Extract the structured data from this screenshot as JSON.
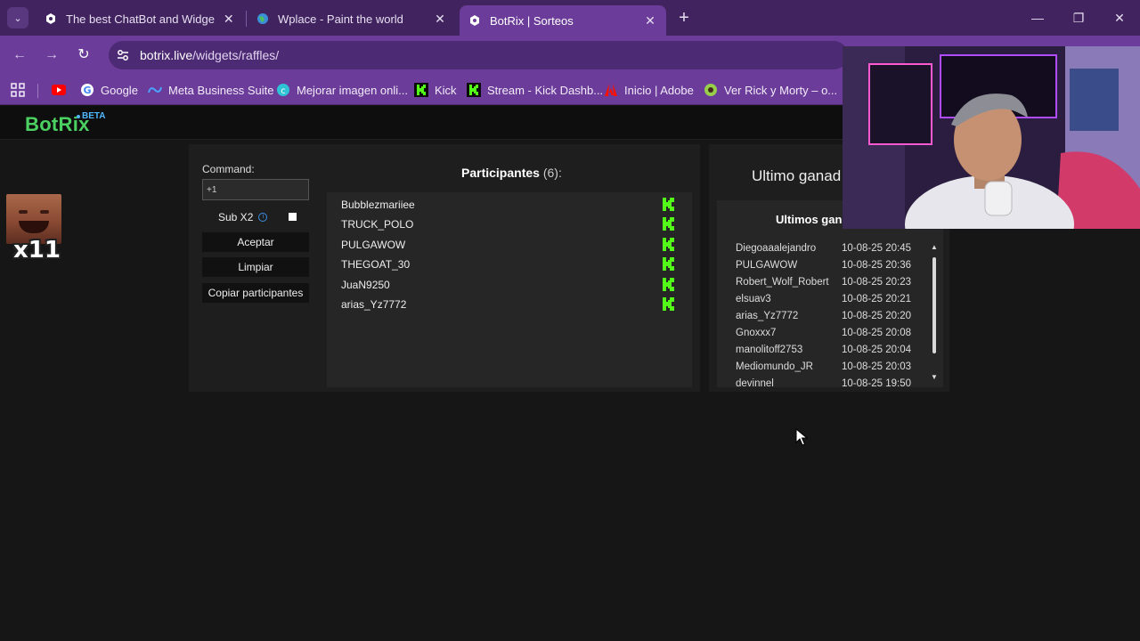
{
  "browser": {
    "tabs": [
      {
        "title": "The best ChatBot and Widgets f",
        "active": false
      },
      {
        "title": "Wplace - Paint the world",
        "active": false
      },
      {
        "title": "BotRix | Sorteos",
        "active": true
      }
    ],
    "url_host": "botrix.live",
    "url_path": "/widgets/raffles/",
    "bookmarks": [
      {
        "label": ""
      },
      {
        "label": "Google"
      },
      {
        "label": "Meta Business Suite"
      },
      {
        "label": "Mejorar imagen onli..."
      },
      {
        "label": "Kick"
      },
      {
        "label": "Stream - Kick Dashb..."
      },
      {
        "label": "Inicio | Adobe"
      },
      {
        "label": "Ver Rick y Morty – o..."
      }
    ]
  },
  "site": {
    "logo": "BotRix",
    "beta": "BETA"
  },
  "emote": {
    "label": "x11"
  },
  "raffle": {
    "command_label": "Command:",
    "command_value": "+1",
    "sub_label": "Sub X2",
    "accept_label": "Aceptar",
    "clear_label": "Limpiar",
    "copy_label": "Copiar participantes",
    "participants_title": "Participantes",
    "participants_count": "(6):",
    "participants": [
      "Bubblezmariiee",
      "TRUCK_POLO",
      "PULGAWOW",
      "THEGOAT_30",
      "JuaN9250",
      "arias_Yz7772"
    ]
  },
  "winners": {
    "last_winner_title": "Ultimo ganad",
    "history_title": "Ultimos gan",
    "rows": [
      {
        "name": "Diegoaaalejandro",
        "date": "10-08-25 20:45"
      },
      {
        "name": "PULGAWOW",
        "date": "10-08-25 20:36"
      },
      {
        "name": "Robert_Wolf_Robert",
        "date": "10-08-25 20:23"
      },
      {
        "name": "elsuav3",
        "date": "10-08-25 20:21"
      },
      {
        "name": "arias_Yz7772",
        "date": "10-08-25 20:20"
      },
      {
        "name": "Gnoxxx7",
        "date": "10-08-25 20:08"
      },
      {
        "name": "manolitoff2753",
        "date": "10-08-25 20:04"
      },
      {
        "name": "Mediomundo_JR",
        "date": "10-08-25 20:03"
      },
      {
        "name": "devinnel",
        "date": "10-08-25 19:50"
      }
    ]
  },
  "colors": {
    "tabstrip": "#41245f",
    "toolbar": "#6b3c99",
    "brand_green": "#4bd161",
    "kick_green": "#53fc18"
  }
}
